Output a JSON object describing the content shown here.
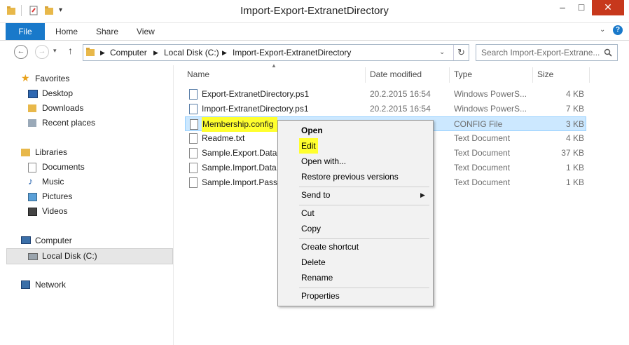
{
  "window": {
    "title": "Import-Export-ExtranetDirectory"
  },
  "ribbon": {
    "file": "File",
    "tabs": [
      "Home",
      "Share",
      "View"
    ]
  },
  "address": {
    "path": [
      "Computer",
      "Local Disk (C:)",
      "Import-Export-ExtranetDirectory"
    ]
  },
  "search": {
    "placeholder": "Search Import-Export-Extrane..."
  },
  "nav": {
    "favorites": "Favorites",
    "fav_items": [
      "Desktop",
      "Downloads",
      "Recent places"
    ],
    "libraries": "Libraries",
    "lib_items": [
      "Documents",
      "Music",
      "Pictures",
      "Videos"
    ],
    "computer": "Computer",
    "local_disk": "Local Disk (C:)",
    "network": "Network"
  },
  "columns": {
    "name": "Name",
    "date": "Date modified",
    "type": "Type",
    "size": "Size"
  },
  "files": [
    {
      "name": "Export-ExtranetDirectory.ps1",
      "date": "20.2.2015 16:54",
      "type": "Windows PowerS...",
      "size": "4 KB"
    },
    {
      "name": "Import-ExtranetDirectory.ps1",
      "date": "20.2.2015 16:54",
      "type": "Windows PowerS...",
      "size": "7 KB"
    },
    {
      "name": "Membership.config",
      "date": "",
      "type": "CONFIG File",
      "size": "3 KB"
    },
    {
      "name": "Readme.txt",
      "date": "",
      "type": "Text Document",
      "size": "4 KB"
    },
    {
      "name": "Sample.Export.Data.txt",
      "date": "",
      "type": "Text Document",
      "size": "37 KB"
    },
    {
      "name": "Sample.Import.Data.txt",
      "date": "",
      "type": "Text Document",
      "size": "1 KB"
    },
    {
      "name": "Sample.Import.Passwords.txt",
      "date": "",
      "type": "Text Document",
      "size": "1 KB"
    }
  ],
  "context_menu": {
    "open": "Open",
    "edit": "Edit",
    "open_with": "Open with...",
    "restore": "Restore previous versions",
    "send_to": "Send to",
    "cut": "Cut",
    "copy": "Copy",
    "create_shortcut": "Create shortcut",
    "delete": "Delete",
    "rename": "Rename",
    "properties": "Properties"
  },
  "colors": {
    "accent": "#1979ca",
    "highlight": "#ffff2e",
    "selection": "#cce8ff",
    "close": "#c7381c"
  }
}
